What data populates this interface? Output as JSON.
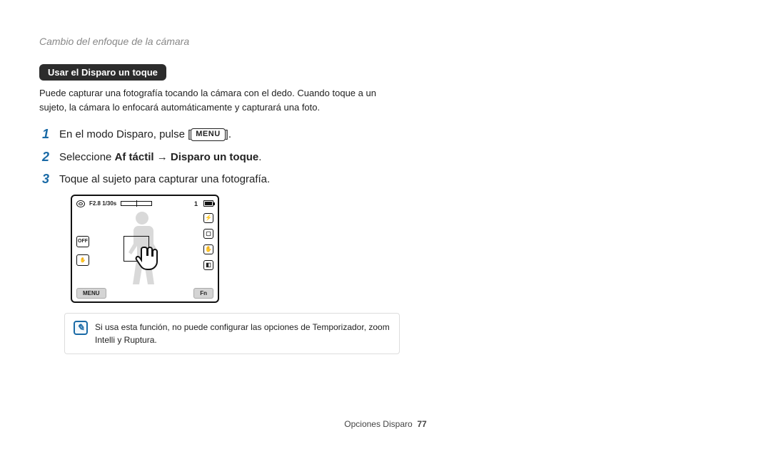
{
  "running_head": "Cambio del enfoque de la cámara",
  "section_title": "Usar el Disparo un toque",
  "intro": "Puede capturar una fotografía tocando la cámara con el dedo. Cuando toque a un sujeto, la cámara lo enfocará automáticamente y capturará una foto.",
  "steps": [
    {
      "num": "1",
      "pre": "En el modo Disparo, pulse [",
      "menu": "MENU",
      "post": "]."
    },
    {
      "num": "2",
      "pre": "Seleccione ",
      "bold1": "Af táctil",
      "arrow": " → ",
      "bold2": "Disparo un toque",
      "post": "."
    },
    {
      "num": "3",
      "text": "Toque al sujeto para capturar una fotografía."
    }
  ],
  "camera": {
    "exposure": "F2.8 1/30s",
    "count": "1",
    "btn_menu": "MENU",
    "btn_fn": "Fn",
    "left_icons": [
      "OFF",
      "✋"
    ],
    "right_icons": [
      "⚡",
      "▢",
      "✋",
      "◧"
    ]
  },
  "note_text": "Si usa esta función, no puede configurar las opciones de Temporizador, zoom Intelli y Ruptura.",
  "footer_label": "Opciones Disparo",
  "footer_page": "77"
}
